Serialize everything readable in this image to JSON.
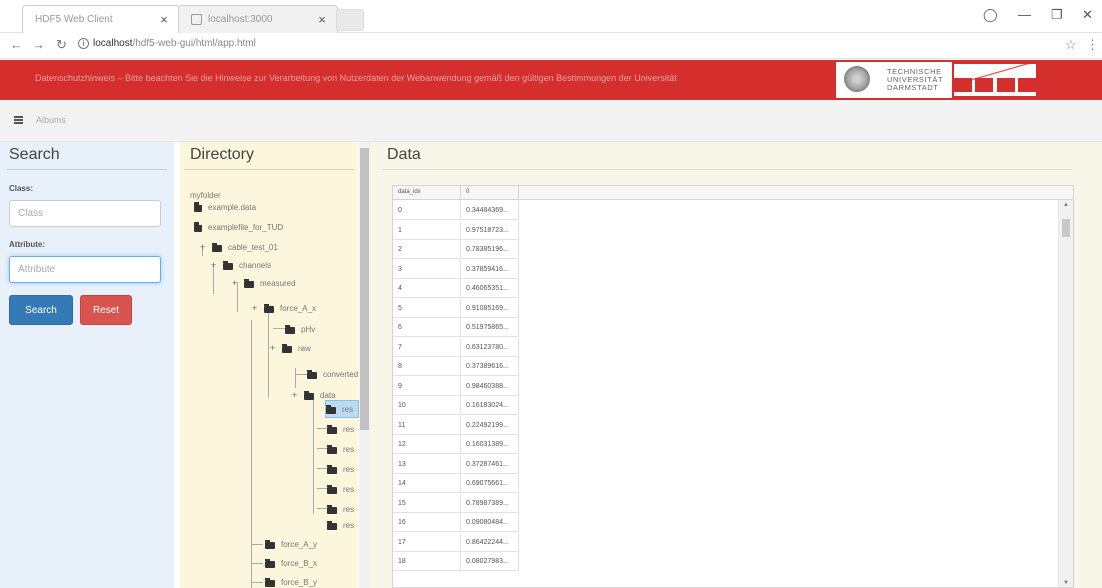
{
  "browser": {
    "tabs": [
      {
        "title": "HDF5 Web Client",
        "active": true
      },
      {
        "title": "localhost:3000",
        "active": false
      }
    ],
    "url_host": "localhost",
    "url_path": "/hdf5-web-gui/html/app.html"
  },
  "header": {
    "banner_text": "Datenschutzhinweis – Bitte beachten Sie die Hinweise zur Verarbeitung von Nutzerdaten der Webanwendung gemäß den gültigen Bestimmungen der Universität",
    "university_lines": [
      "TECHNISCHE",
      "UNIVERSITÄT",
      "DARMSTADT"
    ],
    "nav_label": "Albums",
    "brand_color": "#d42f2d"
  },
  "search": {
    "title": "Search",
    "class_label": "Class:",
    "class_placeholder": "Class",
    "attribute_label": "Attribute:",
    "attribute_placeholder": "Attribute",
    "search_button": "Search",
    "reset_button": "Reset"
  },
  "directory": {
    "title": "Directory",
    "root": "myfolder",
    "nodes": [
      {
        "label": "example.data",
        "type": "file"
      },
      {
        "label": "examplefile_for_TUD",
        "type": "file"
      },
      {
        "label": "cable_test_01",
        "type": "folder"
      },
      {
        "label": "channels",
        "type": "folder"
      },
      {
        "label": "measured",
        "type": "folder"
      },
      {
        "label": "force_A_x",
        "type": "folder"
      },
      {
        "label": "pHv",
        "type": "folder"
      },
      {
        "label": "raw",
        "type": "folder"
      },
      {
        "label": "converted",
        "type": "folder"
      },
      {
        "label": "data",
        "type": "folder"
      },
      {
        "label": "res",
        "type": "folder",
        "selected": true
      },
      {
        "label": "res",
        "type": "folder"
      },
      {
        "label": "res",
        "type": "folder"
      },
      {
        "label": "res",
        "type": "folder"
      },
      {
        "label": "res",
        "type": "folder"
      },
      {
        "label": "res",
        "type": "folder"
      },
      {
        "label": "res",
        "type": "folder"
      },
      {
        "label": "force_A_y",
        "type": "folder"
      },
      {
        "label": "force_B_x",
        "type": "folder"
      },
      {
        "label": "force_B_y",
        "type": "folder"
      }
    ]
  },
  "data": {
    "title": "Data",
    "columns": [
      "data_idx",
      "0"
    ],
    "rows": [
      [
        "0",
        "0.34484369..."
      ],
      [
        "1",
        "0.97518723..."
      ],
      [
        "2",
        "0.78385196..."
      ],
      [
        "3",
        "0.37859416..."
      ],
      [
        "4",
        "0.46065351..."
      ],
      [
        "5",
        "0.91085169..."
      ],
      [
        "6",
        "0.51975865..."
      ],
      [
        "7",
        "0.63123780..."
      ],
      [
        "8",
        "0.37389616..."
      ],
      [
        "9",
        "0.98460388..."
      ],
      [
        "10",
        "0.16183024..."
      ],
      [
        "11",
        "0.22492199..."
      ],
      [
        "12",
        "0.16031389..."
      ],
      [
        "13",
        "0.37287461..."
      ],
      [
        "14",
        "0.69075661..."
      ],
      [
        "15",
        "0.78987389..."
      ],
      [
        "16",
        "0.09080484..."
      ],
      [
        "17",
        "0.86422244..."
      ],
      [
        "18",
        "0.08027983..."
      ]
    ]
  }
}
